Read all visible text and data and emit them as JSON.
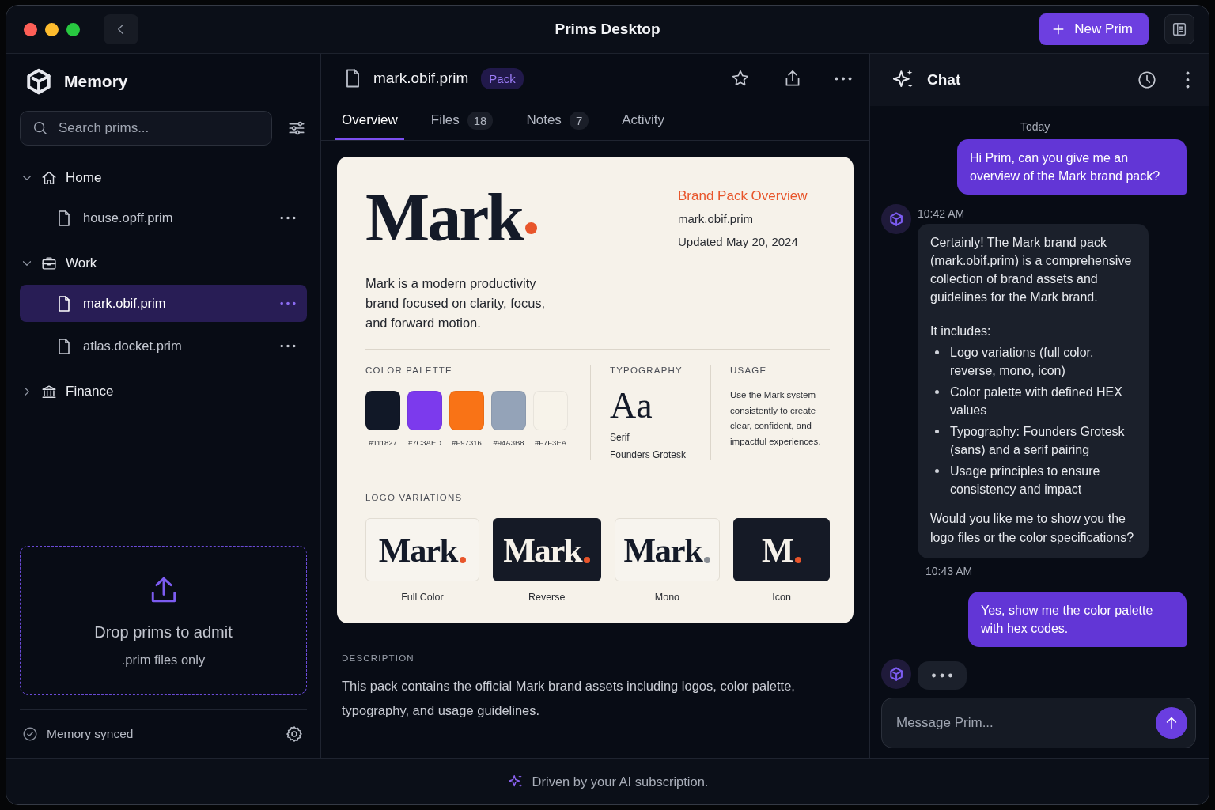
{
  "window": {
    "title": "Prims Desktop",
    "new_button": "New Prim"
  },
  "sidebar": {
    "title": "Memory",
    "search": {
      "placeholder": "Search prims..."
    },
    "tree": [
      {
        "label": "Home",
        "kind": "home",
        "expanded": true,
        "children": [
          {
            "label": "house.opff.prim",
            "selected": false
          }
        ]
      },
      {
        "label": "Work",
        "kind": "work",
        "expanded": true,
        "children": [
          {
            "label": "mark.obif.prim",
            "selected": true
          },
          {
            "label": "atlas.docket.prim",
            "selected": false
          }
        ]
      },
      {
        "label": "Finance",
        "kind": "finance",
        "expanded": false
      }
    ],
    "dropzone": {
      "title": "Drop prims to admit",
      "subtitle": ".prim files only"
    },
    "status": "Memory synced"
  },
  "document": {
    "name": "mark.obif.prim",
    "badge": "Pack",
    "tabs": [
      {
        "label": "Overview",
        "selected": true
      },
      {
        "label": "Files",
        "count": "18",
        "selected": false
      },
      {
        "label": "Notes",
        "count": "7",
        "selected": false
      },
      {
        "label": "Activity",
        "selected": false
      }
    ],
    "card": {
      "wordmark": "Mark",
      "intro": "Mark is a modern productivity brand focused on clarity, focus, and forward motion.",
      "heading": "Brand Pack Overview",
      "file": "mark.obif.prim",
      "updated": "Updated May 20, 2024",
      "palette_title": "COLOR PALETTE",
      "swatches": [
        {
          "label": "#111827",
          "color": "#111827"
        },
        {
          "label": "#7C3AED",
          "color": "#7c3aed"
        },
        {
          "label": "#F97316",
          "color": "#f97316"
        },
        {
          "label": "#94A3B8",
          "color": "#94a3b8"
        },
        {
          "label": "#F7F3EA",
          "color": "#f7f3ea"
        }
      ],
      "typography_title": "TYPOGRAPHY",
      "typography_sample": "Aa",
      "fonts": [
        "Serif",
        "Founders Grotesk"
      ],
      "usage_title": "USAGE",
      "usage": "Use the Mark system consistently to create clear, confident, and impactful experiences.",
      "logos_title": "LOGO VARIATIONS",
      "logos": [
        {
          "mark": "Mark",
          "label": "Full Color",
          "dark": false,
          "color": "#e8552b"
        },
        {
          "mark": "Mark",
          "label": "Reverse",
          "dark": true,
          "color": "#e8552b"
        },
        {
          "mark": "Mark",
          "label": "Mono",
          "dark": false,
          "color": "#8a8f96"
        },
        {
          "mark": "M",
          "label": "Icon",
          "dark": true,
          "color": "#e8552b"
        }
      ]
    },
    "description_title": "DESCRIPTION",
    "description": "This pack contains the official Mark brand assets including logos, color palette, typography, and usage guidelines."
  },
  "chat": {
    "title": "Chat",
    "messages": [
      {
        "kind": "divider",
        "text": "Today"
      },
      {
        "kind": "user",
        "text": "Hi Prim, can you give me an overview of the Mark brand pack?"
      },
      {
        "kind": "bot",
        "time": "10:42 AM",
        "intro": "Certainly! The Mark brand pack (mark.obif.prim) is a comprehensive collection of brand assets and guidelines for the Mark brand.",
        "lead": "It includes:",
        "bullets": [
          "Logo variations (full color, reverse, mono, icon)",
          "Color palette with defined HEX values",
          "Typography: Founders Grotesk (sans) and a serif pairing",
          "Usage principles to ensure consistency and impact"
        ],
        "closing": "Would you like me to show you the logo files or the color specifications?"
      },
      {
        "kind": "time",
        "text": "10:43 AM"
      },
      {
        "kind": "user",
        "text": "Yes, show me the color palette with hex codes."
      },
      {
        "kind": "typing"
      }
    ],
    "input": {
      "placeholder": "Message Prim..."
    }
  },
  "footer": "Driven by your AI subscription."
}
